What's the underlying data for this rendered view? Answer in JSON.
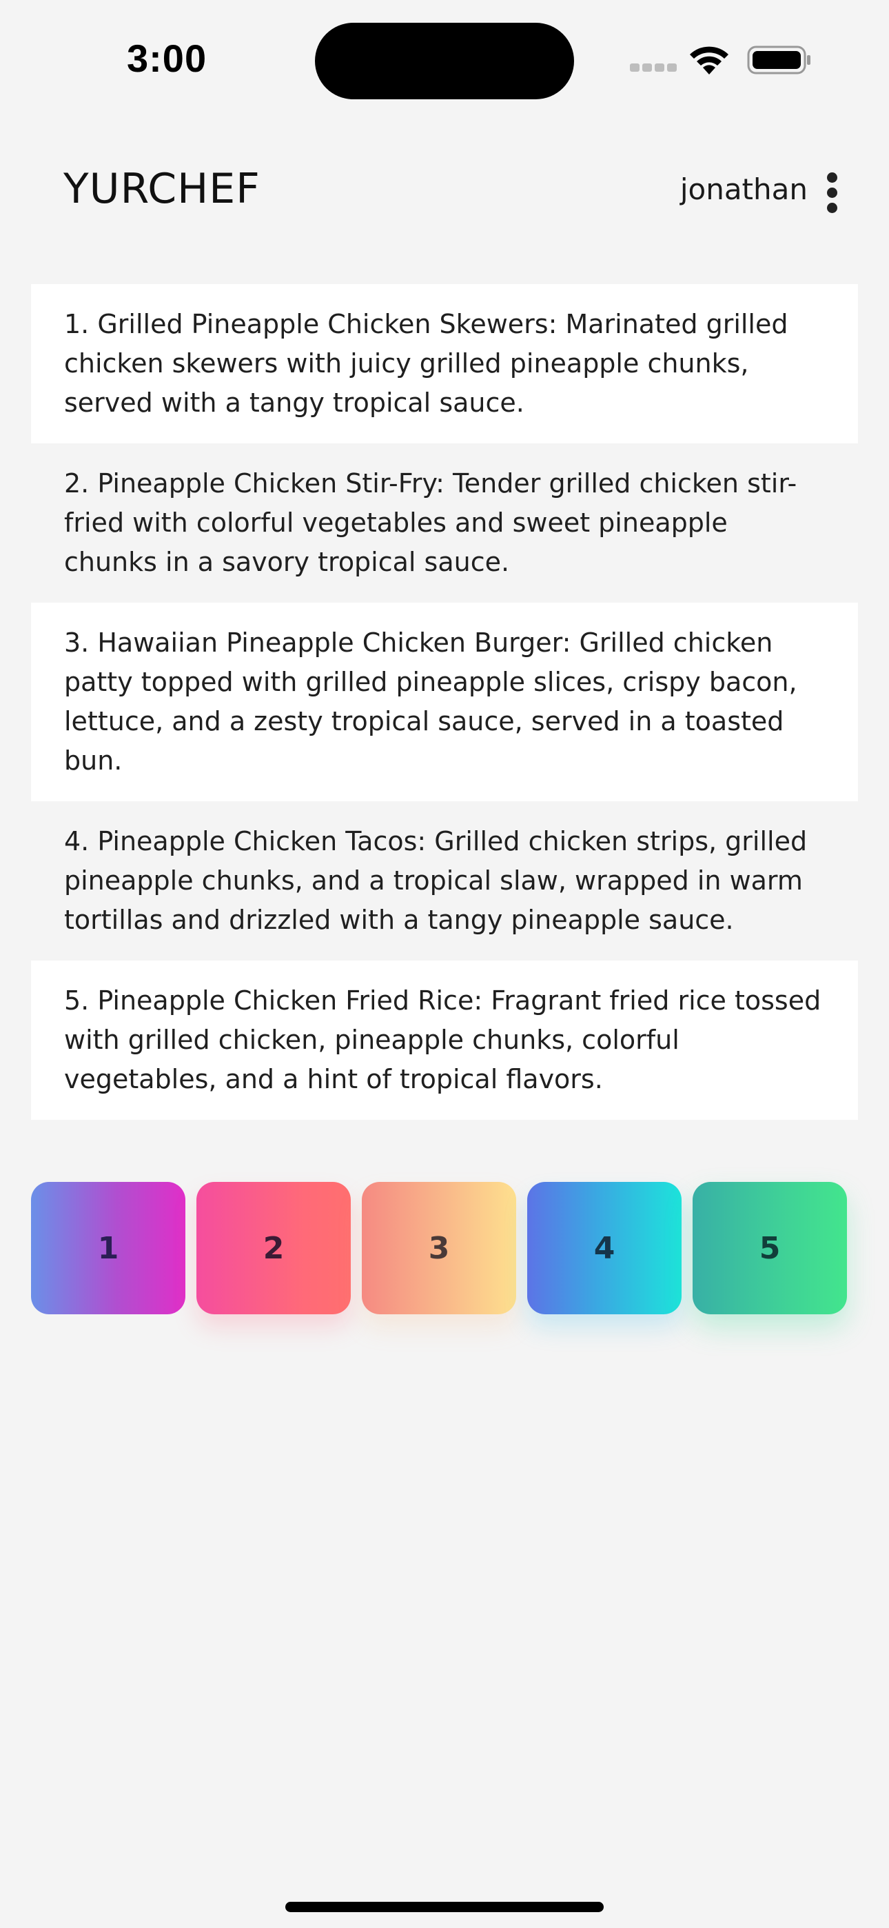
{
  "status_bar": {
    "time": "3:00"
  },
  "header": {
    "app_name": "YURCHEF",
    "username": "jonathan",
    "menu_icon": "more-vertical-icon"
  },
  "recipes": [
    {
      "text": "1. Grilled Pineapple Chicken Skewers: Marinated grilled chicken skewers with juicy grilled pineapple chunks, served with a tangy tropical sauce."
    },
    {
      "text": "2. Pineapple Chicken Stir-Fry: Tender grilled chicken stir-fried with colorful vegetables and sweet pineapple chunks in a savory tropical sauce."
    },
    {
      "text": "3. Hawaiian Pineapple Chicken Burger: Grilled chicken patty topped with grilled pineapple slices, crispy bacon, lettuce, and a zesty tropical sauce, served in a toasted bun."
    },
    {
      "text": "4. Pineapple Chicken Tacos: Grilled chicken strips, grilled pineapple chunks, and a tropical slaw, wrapped in warm tortillas and drizzled with a tangy pineapple sauce."
    },
    {
      "text": "5. Pineapple Chicken Fried Rice: Fragrant fried rice tossed with grilled chicken, pineapple chunks, colorful vegetables, and a hint of tropical flavors."
    }
  ],
  "number_cards": [
    {
      "label": "1"
    },
    {
      "label": "2"
    },
    {
      "label": "3"
    },
    {
      "label": "4"
    },
    {
      "label": "5"
    }
  ],
  "colors": {
    "background": "#f4f4f4",
    "card_row_light": "#ffffff"
  }
}
